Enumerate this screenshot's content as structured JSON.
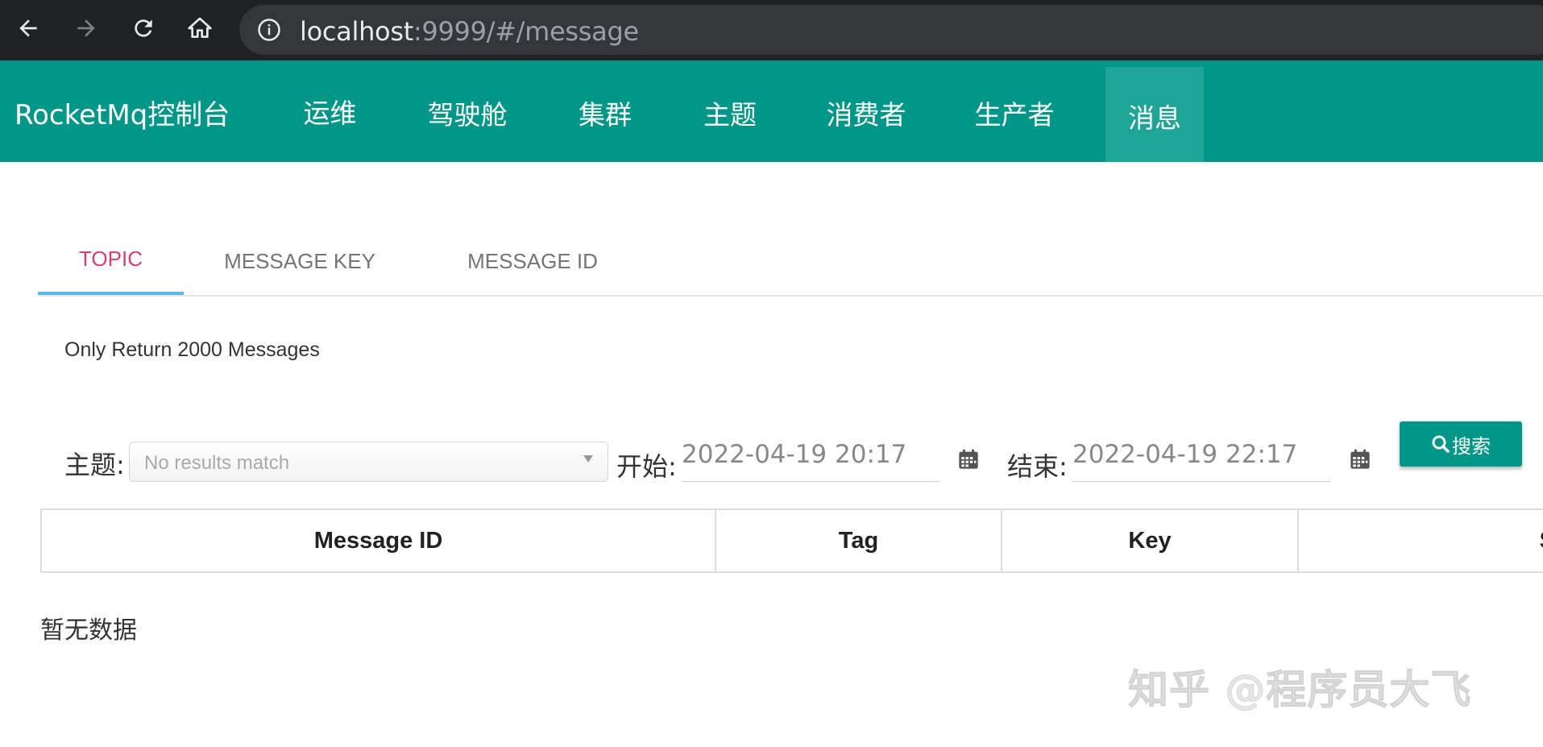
{
  "browser": {
    "url_host": "localhost",
    "url_rest": ":9999/#/message"
  },
  "nav": {
    "brand": "RocketMq控制台",
    "items": [
      {
        "label": "运维"
      },
      {
        "label": "驾驶舱"
      },
      {
        "label": "集群"
      },
      {
        "label": "主题"
      },
      {
        "label": "消费者"
      },
      {
        "label": "生产者"
      },
      {
        "label": "消息",
        "active": true
      }
    ]
  },
  "tabs": [
    {
      "label": "TOPIC",
      "active": true
    },
    {
      "label": "MESSAGE KEY"
    },
    {
      "label": "MESSAGE ID"
    }
  ],
  "notice": "Only Return 2000 Messages",
  "filter": {
    "topic_label": "主题:",
    "topic_placeholder": "No results match",
    "start_label": "开始:",
    "start_value": "2022-04-19 20:17",
    "end_label": "结束:",
    "end_value": "2022-04-19 22:17",
    "search_label": "搜索"
  },
  "table": {
    "columns": [
      "Message ID",
      "Tag",
      "Key",
      "S"
    ]
  },
  "empty_text": "暂无数据",
  "watermark": "知乎 @程序员大飞",
  "colors": {
    "primary": "#009688",
    "tab_active": "#d63f72",
    "tab_indicator": "#58b8ea"
  }
}
